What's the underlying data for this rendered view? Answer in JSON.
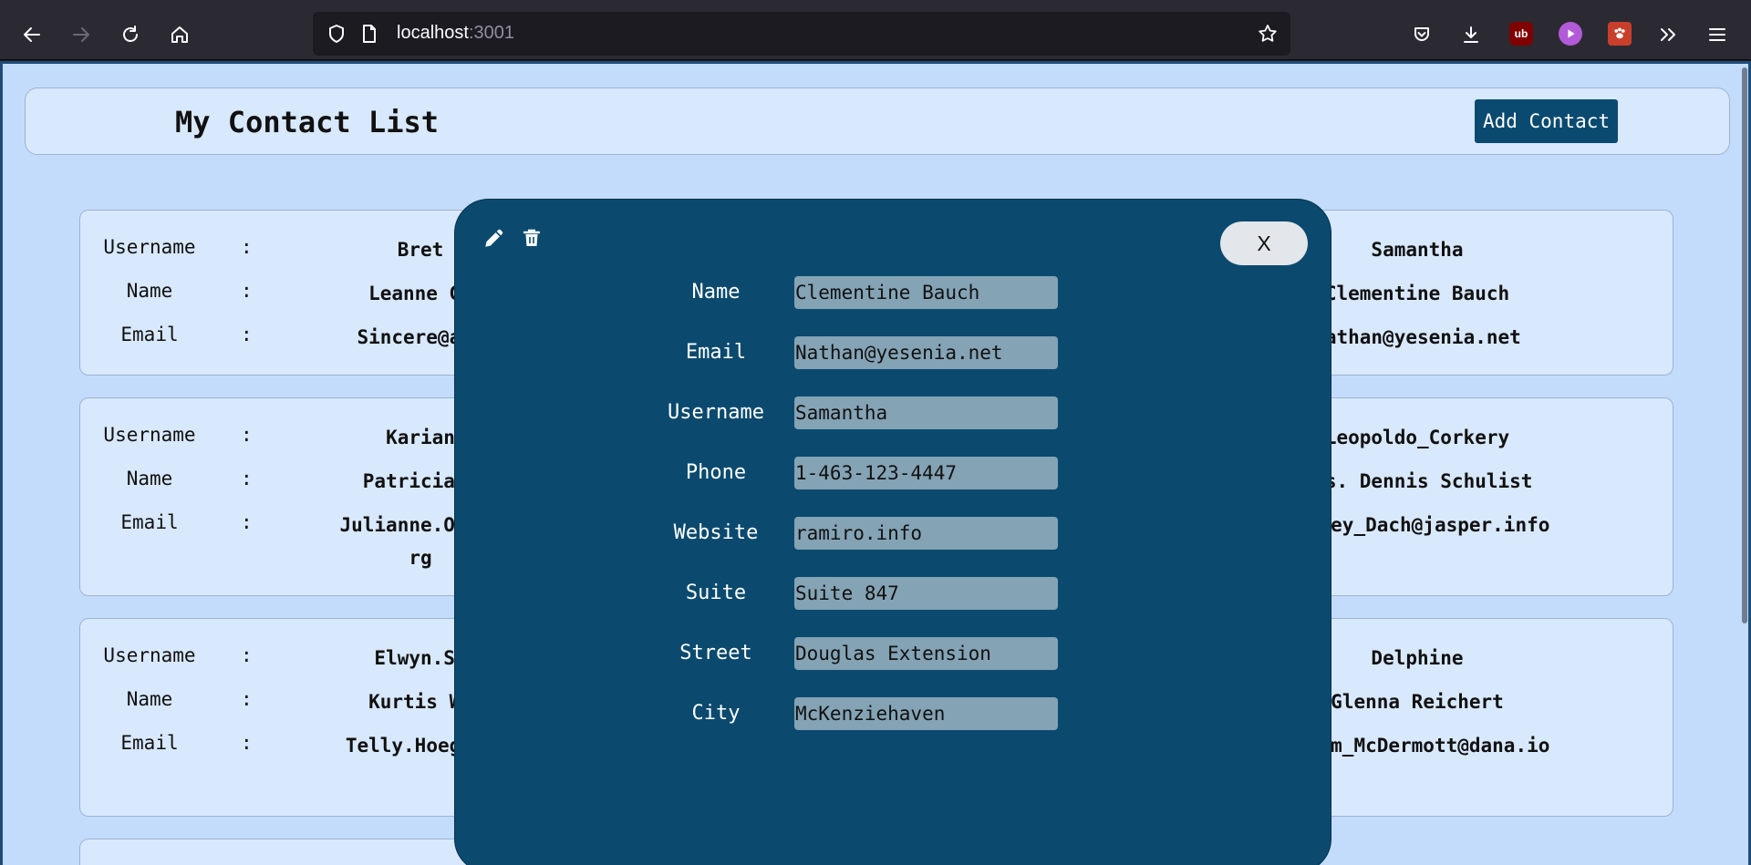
{
  "browser": {
    "url_host": "localhost",
    "url_port": ":3001"
  },
  "header": {
    "title": "My Contact List",
    "add_button": "Add Contact"
  },
  "labels": {
    "username": "Username",
    "name": "Name",
    "email": "Email",
    "colon": ":"
  },
  "cards": [
    {
      "username": "Bret",
      "name": "Leanne Gr",
      "email": "Sincere@apr"
    },
    {
      "username": "Samantha",
      "name": "Clementine Bauch",
      "email": "Nathan@yesenia.net"
    },
    {
      "username": "Karian",
      "name": "Patricia L",
      "email": "Julianne.OConn\nrg"
    },
    {
      "username": "Leopoldo_Corkery",
      "name": "Mrs. Dennis Schulist",
      "email": "Karley_Dach@jasper.info"
    },
    {
      "username": "Elwyn.Sk",
      "name": "Kurtis We",
      "email": "Telly.Hoeger@"
    },
    {
      "username": "Delphine",
      "name": "Glenna Reichert",
      "email": "Chaim_McDermott@dana.io"
    }
  ],
  "modal": {
    "close_label": "X",
    "fields": [
      {
        "label": "Name",
        "value": "Clementine Bauch"
      },
      {
        "label": "Email",
        "value": "Nathan@yesenia.net"
      },
      {
        "label": "Username",
        "value": "Samantha"
      },
      {
        "label": "Phone",
        "value": "1-463-123-4447"
      },
      {
        "label": "Website",
        "value": "ramiro.info"
      },
      {
        "label": "Suite",
        "value": "Suite 847"
      },
      {
        "label": "Street",
        "value": "Douglas Extension"
      },
      {
        "label": "City",
        "value": "McKenziehaven"
      }
    ]
  }
}
